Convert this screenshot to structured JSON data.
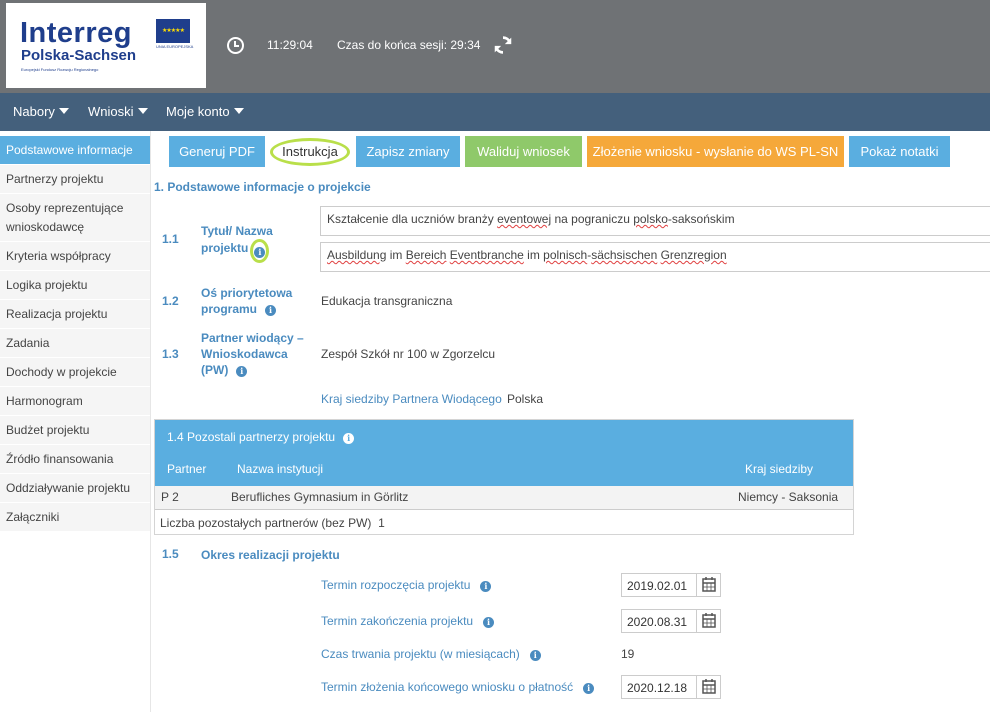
{
  "header": {
    "logo_line1": "Interreg",
    "logo_line2": "Polska-Sachsen",
    "logo_line3": "Europejski Fundusz Rozwoju Regionalnego",
    "logo_eu": "UNIA EUROPEJSKA",
    "time": "11:29:04",
    "session": "Czas do końca sesji: 29:34"
  },
  "nav": {
    "items": [
      "Nabory",
      "Wnioski",
      "Moje konto"
    ]
  },
  "sidebar": {
    "items": [
      "Podstawowe informacje",
      "Partnerzy projektu",
      "Osoby reprezentujące wnioskodawcę",
      "Kryteria współpracy",
      "Logika projektu",
      "Realizacja projektu",
      "Zadania",
      "Dochody w projekcie",
      "Harmonogram",
      "Budżet projektu",
      "Źródło finansowania",
      "Oddziaływanie projektu",
      "Załączniki"
    ]
  },
  "toolbar": {
    "pdf": "Generuj PDF",
    "instr": "Instrukcja",
    "save": "Zapisz zmiany",
    "validate": "Waliduj wniosek",
    "submit": "Złożenie wniosku - wysłanie do WS PL-SN",
    "notes": "Pokaż notatki"
  },
  "form": {
    "section": "1. Podstawowe informacje o projekcie",
    "f11": {
      "num": "1.1",
      "label_a": "Tytuł/ Nazwa",
      "label_b": "projektu"
    },
    "f12": {
      "num": "1.2",
      "label_a": "Oś priorytetowa",
      "label_b": "programu",
      "value": "Edukacja transgraniczna"
    },
    "f13": {
      "num": "1.3",
      "label_a": "Partner wiodący –",
      "label_b": "Wnioskodawca",
      "label_c": "(PW)",
      "value": "Zespół Szkół nr 100 w Zgorzelcu"
    },
    "country_label": "Kraj siedziby Partnera Wiodącego",
    "country_value": "Polska"
  },
  "partners": {
    "title": "1.4 Pozostali partnerzy projektu",
    "col_partner": "Partner",
    "col_name": "Nazwa instytucji",
    "col_country": "Kraj siedziby",
    "rows": [
      {
        "partner": "P 2",
        "name": "Berufliches Gymnasium in Görlitz",
        "country": "Niemcy - Saksonia"
      }
    ],
    "count_label": "Liczba pozostałych partnerów (bez PW)",
    "count_value": "1"
  },
  "period": {
    "num": "1.5",
    "title": "Okres realizacji projektu",
    "start_label": "Termin rozpoczęcia projektu",
    "start_value": "2019.02.01",
    "end_label": "Termin zakończenia projektu",
    "end_value": "2020.08.31",
    "duration_label": "Czas trwania projektu (w miesiącach)",
    "duration_value": "19",
    "final_label": "Termin złożenia końcowego wniosku o płatność",
    "final_value": "2020.12.18"
  },
  "colors": {
    "accent_blue": "#5aaee0",
    "nav_bg": "#44607c",
    "header_bg": "#6f7275",
    "green": "#8fc96a",
    "orange": "#f5a83a",
    "highlight": "#b9df4a"
  }
}
